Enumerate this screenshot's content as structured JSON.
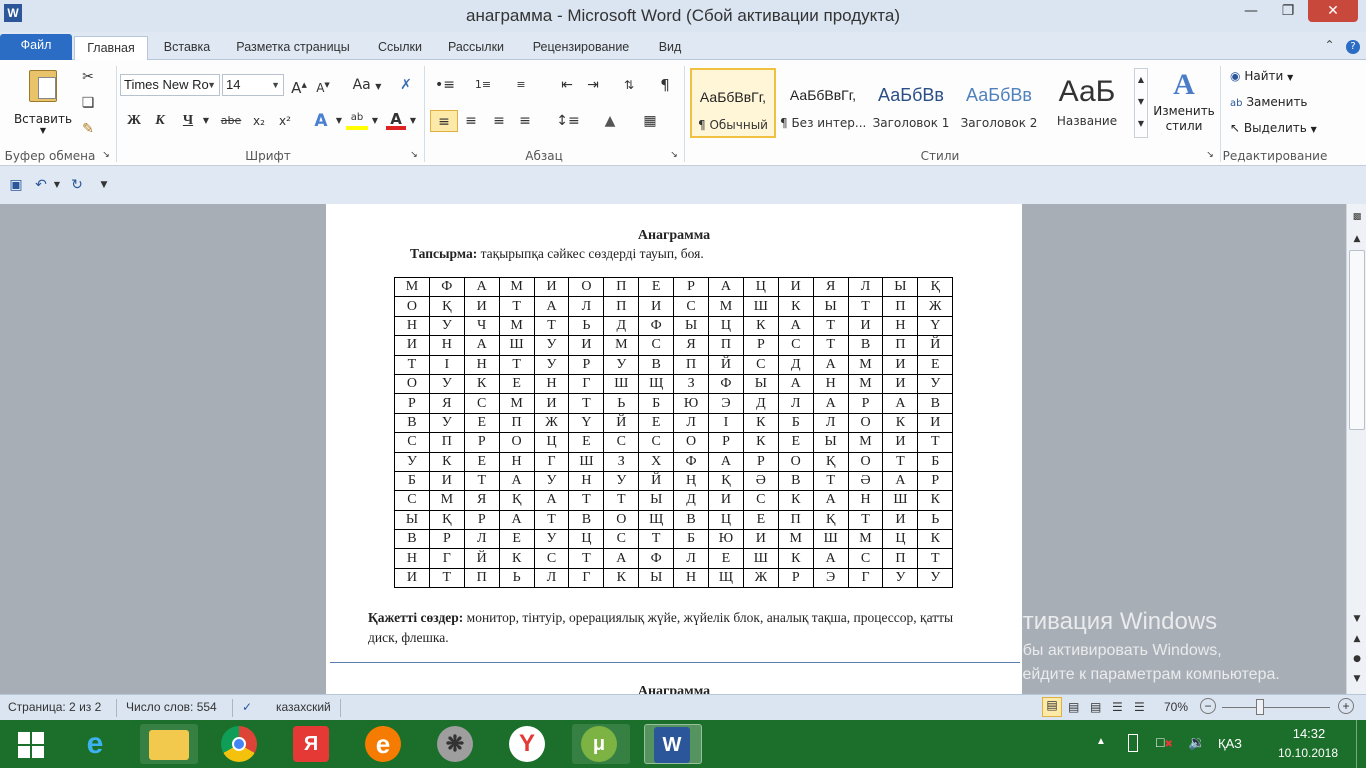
{
  "window": {
    "title": "анаграмма  -  Microsoft Word (Сбой активации продукта)",
    "app_icon_letter": "W"
  },
  "ribbon_tabs": [
    "Файл",
    "Главная",
    "Вставка",
    "Разметка страницы",
    "Ссылки",
    "Рассылки",
    "Рецензирование",
    "Вид"
  ],
  "clipboard": {
    "paste_label": "Вставить",
    "group_label": "Буфер обмена"
  },
  "font": {
    "font_name": "Times New Ro",
    "font_size": "14",
    "group_label": "Шрифт",
    "bold": "Ж",
    "italic": "К",
    "underline": "Ч",
    "strike": "abe",
    "subscript": "x₂",
    "superscript": "x²",
    "grow": "A",
    "shrink": "A",
    "case": "Aa"
  },
  "paragraph": {
    "group_label": "Абзац"
  },
  "styles": {
    "group_label": "Стили",
    "items": [
      {
        "preview": "АаБбВвГг,",
        "name": "¶ Обычный"
      },
      {
        "preview": "АаБбВвГг,",
        "name": "¶ Без интер..."
      },
      {
        "preview": "АаБбВв",
        "name": "Заголовок 1"
      },
      {
        "preview": "АаБбВв",
        "name": "Заголовок 2"
      },
      {
        "preview": "АаБ",
        "name": "Название"
      }
    ],
    "change_styles": "Изменить стили"
  },
  "editing": {
    "group_label": "Редактирование",
    "find": "Найти",
    "replace": "Заменить",
    "select": "Выделить"
  },
  "document": {
    "title": "Анаграмма",
    "task_label": "Тапсырма:",
    "task_text": " тақырыпқа сәйкес сөздерді  тауып, боя.",
    "grid": [
      [
        "М",
        "Ф",
        "А",
        "М",
        "И",
        "О",
        "П",
        "Е",
        "Р",
        "А",
        "Ц",
        "И",
        "Я",
        "Л",
        "Ы",
        "Қ"
      ],
      [
        "О",
        "Қ",
        "И",
        "Т",
        "А",
        "Л",
        "П",
        "И",
        "С",
        "М",
        "Ш",
        "К",
        "Ы",
        "Т",
        "П",
        "Ж"
      ],
      [
        "Н",
        "У",
        "Ч",
        "М",
        "Т",
        "Ь",
        "Д",
        "Ф",
        "Ы",
        "Ц",
        "К",
        "А",
        "Т",
        "И",
        "Н",
        "Ү"
      ],
      [
        "И",
        "Н",
        "А",
        "Ш",
        "У",
        "И",
        "М",
        "С",
        "Я",
        "П",
        "Р",
        "С",
        "Т",
        "В",
        "П",
        "Й"
      ],
      [
        "Т",
        "І",
        "Н",
        "Т",
        "У",
        "Р",
        "У",
        "В",
        "П",
        "Й",
        "С",
        "Д",
        "А",
        "М",
        "И",
        "Е"
      ],
      [
        "О",
        "У",
        "К",
        "Е",
        "Н",
        "Г",
        "Ш",
        "Щ",
        "З",
        "Ф",
        "Ы",
        "А",
        "Н",
        "М",
        "И",
        "У"
      ],
      [
        "Р",
        "Я",
        "С",
        "М",
        "И",
        "Т",
        "Ь",
        "Б",
        "Ю",
        "Э",
        "Д",
        "Л",
        "А",
        "Р",
        "А",
        "В"
      ],
      [
        "В",
        "У",
        "Е",
        "П",
        "Ж",
        "Ү",
        "Й",
        "Е",
        "Л",
        "І",
        "К",
        "Б",
        "Л",
        "О",
        "К",
        "И"
      ],
      [
        "С",
        "П",
        "Р",
        "О",
        "Ц",
        "Е",
        "С",
        "С",
        "О",
        "Р",
        "К",
        "Е",
        "Ы",
        "М",
        "И",
        "Т"
      ],
      [
        "У",
        "К",
        "Е",
        "Н",
        "Г",
        "Ш",
        "З",
        "Х",
        "Ф",
        "А",
        "Р",
        "О",
        "Қ",
        "О",
        "Т",
        "Б"
      ],
      [
        "Б",
        "И",
        "Т",
        "А",
        "У",
        "Н",
        "У",
        "Й",
        "Ң",
        "Қ",
        "Ә",
        "В",
        "Т",
        "Ә",
        "А",
        "Р"
      ],
      [
        "С",
        "М",
        "Я",
        "Қ",
        "А",
        "Т",
        "Т",
        "Ы",
        "Д",
        "И",
        "С",
        "К",
        "А",
        "Н",
        "Ш",
        "К"
      ],
      [
        "Ы",
        "Қ",
        "Р",
        "А",
        "Т",
        "В",
        "О",
        "Щ",
        "В",
        "Ц",
        "Е",
        "П",
        "Қ",
        "Т",
        "И",
        "Ь"
      ],
      [
        "В",
        "Р",
        "Л",
        "Е",
        "У",
        "Ц",
        "С",
        "Т",
        "Б",
        "Ю",
        "И",
        "М",
        "Ш",
        "М",
        "Ц",
        "К"
      ],
      [
        "Н",
        "Г",
        "Й",
        "К",
        "С",
        "Т",
        "А",
        "Ф",
        "Л",
        "Е",
        "Ш",
        "К",
        "А",
        "С",
        "П",
        "Т"
      ],
      [
        "И",
        "Т",
        "П",
        "Ь",
        "Л",
        "Г",
        "К",
        "Ы",
        "Н",
        "Щ",
        "Ж",
        "Р",
        "Э",
        "Г",
        "У",
        "У"
      ]
    ],
    "needed_label": "Қажетті сөздер:",
    "needed_text": " монитор, тінтуір, орерациялық жүйе, жүйелік блок, аналық тақша, процессор, қатты диск, флешка.",
    "next_page_title": "Анаграмма"
  },
  "watermark": {
    "line1": "Активация Windows",
    "line2": "Чтобы активировать Windows,",
    "line3": "перейдите к параметрам компьютера."
  },
  "statusbar": {
    "page": "Страница: 2 из 2",
    "words": "Число слов: 554",
    "language": "казахский",
    "zoom": "70%"
  },
  "taskbar": {
    "lang": "ҚАЗ",
    "time": "14:32",
    "date": "10.10.2018"
  }
}
